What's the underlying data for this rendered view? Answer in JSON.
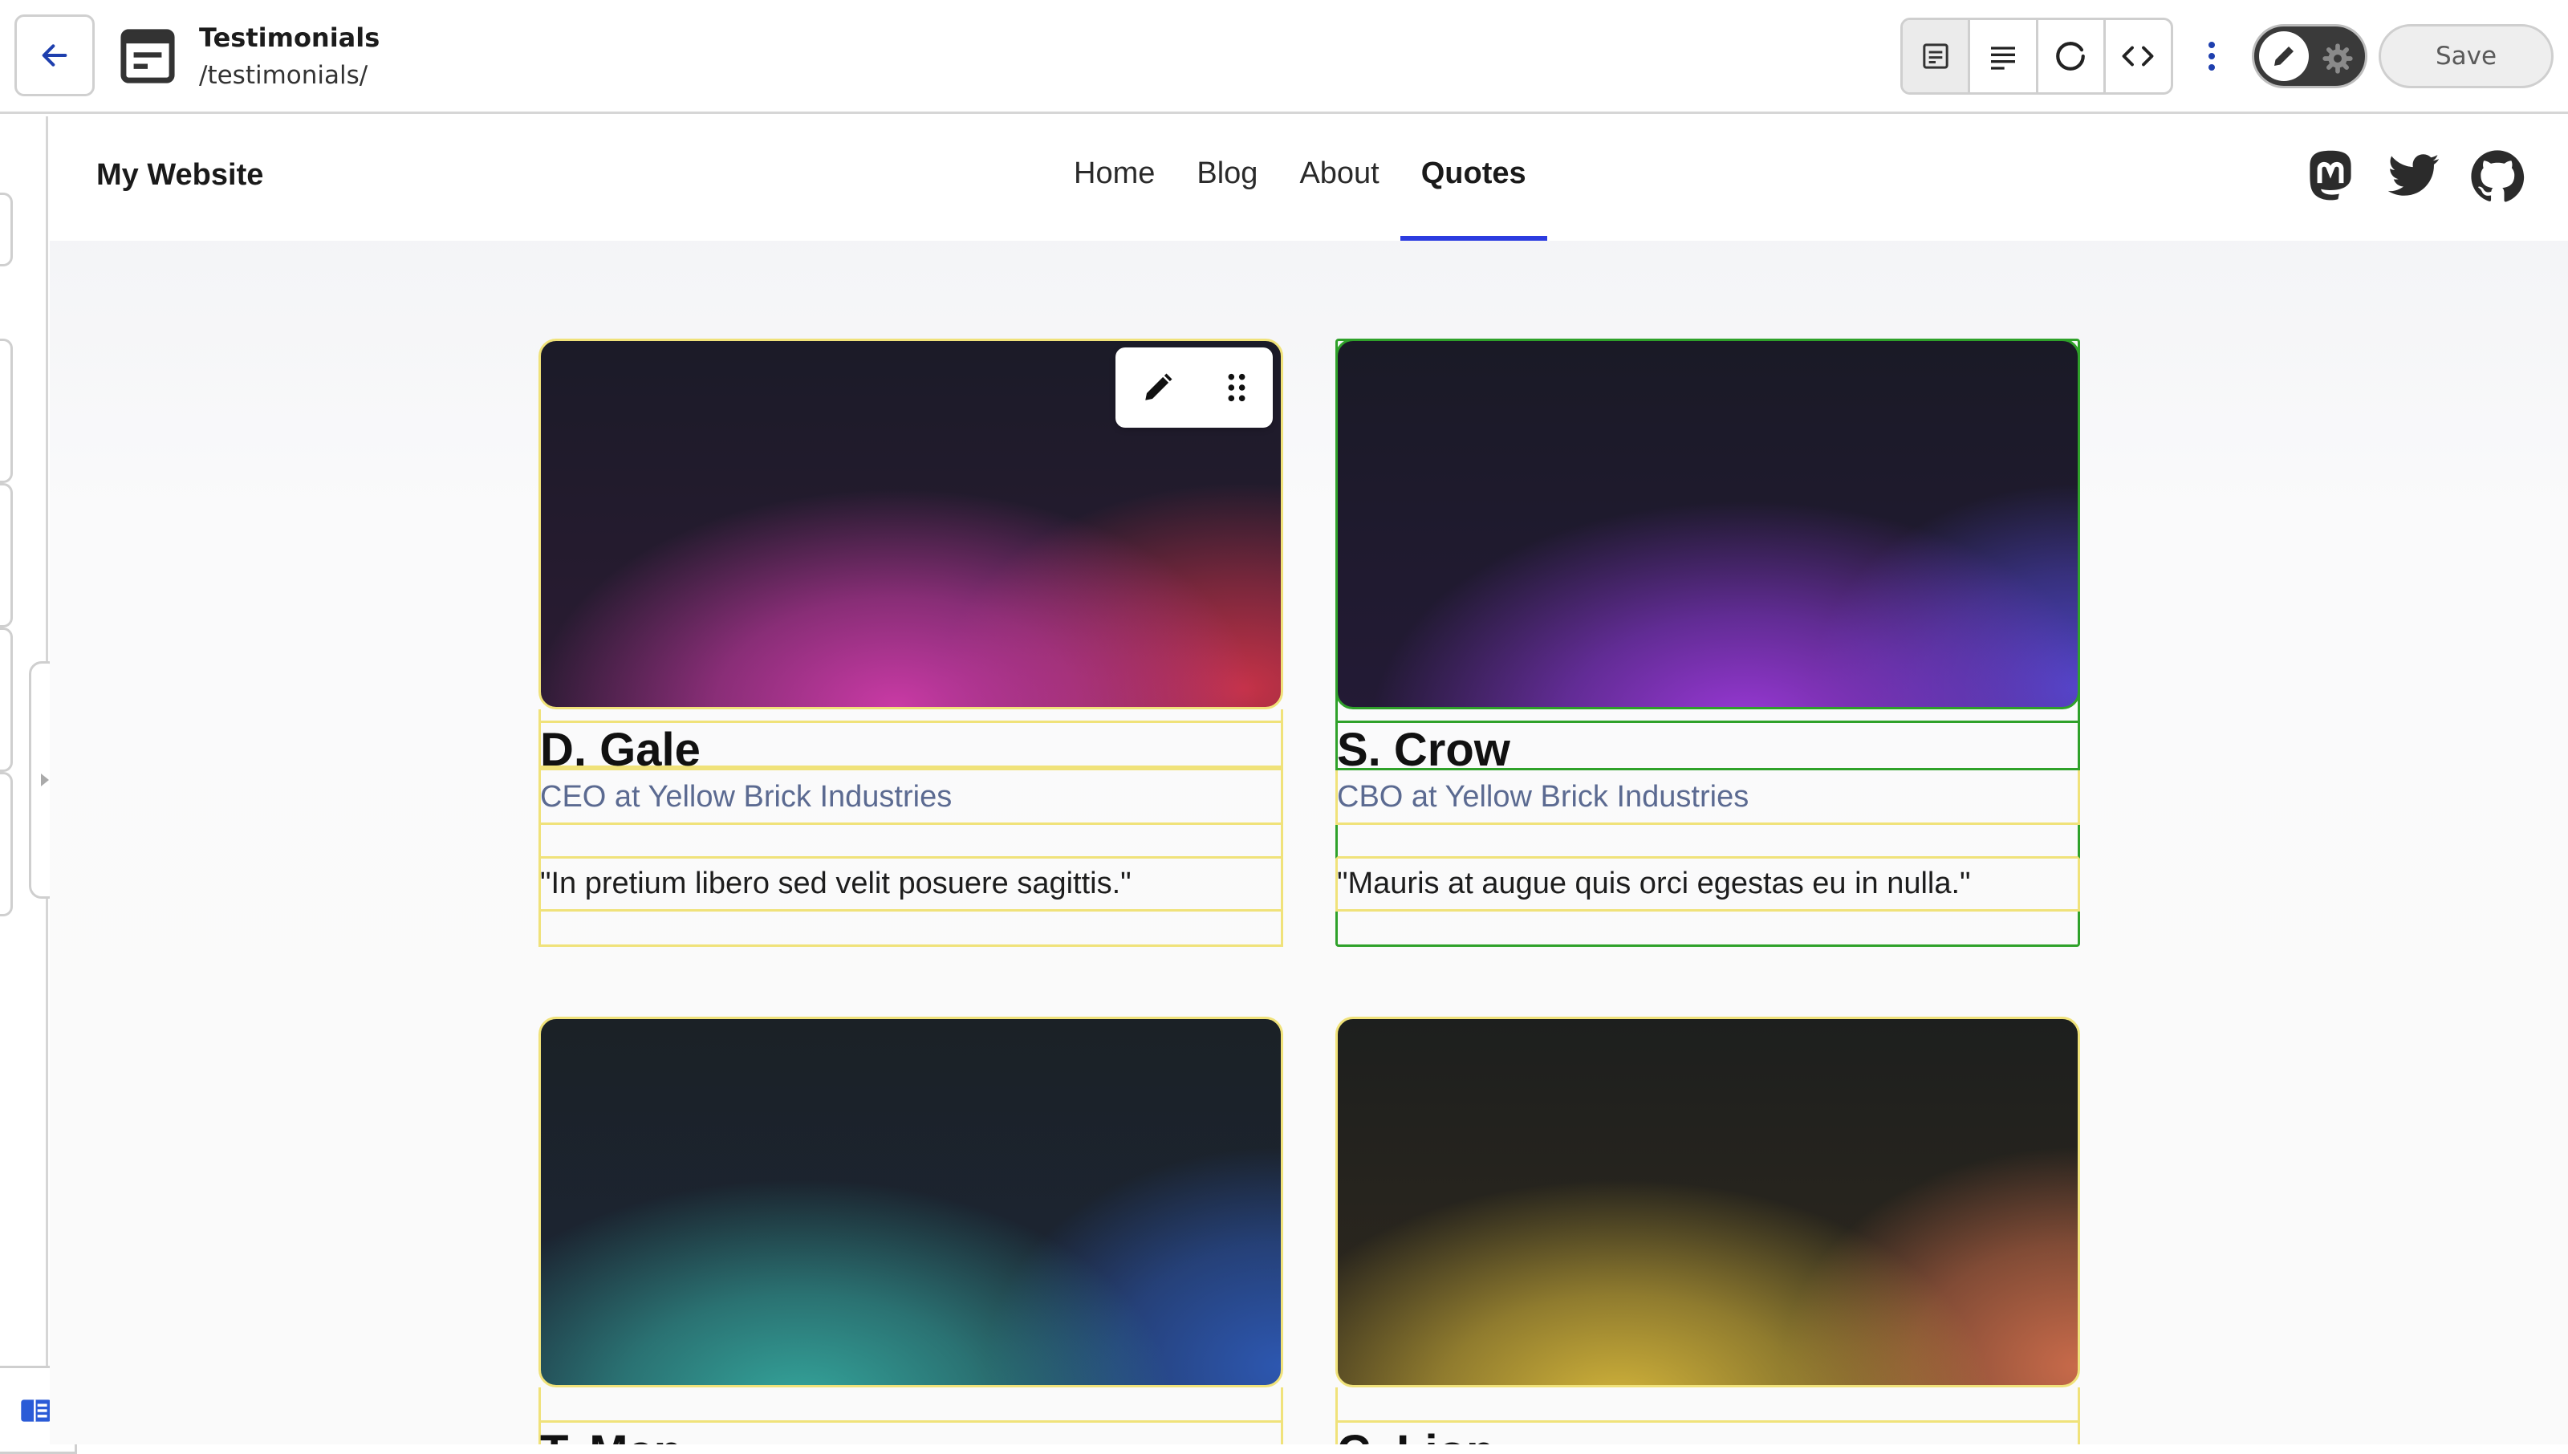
{
  "toolbar": {
    "page_title": "Testimonials",
    "page_path": "/testimonials/",
    "save_label": "Save",
    "icons": {
      "back": "arrow-left-icon",
      "page": "document-icon",
      "views": [
        "form-view-icon",
        "text-lines-icon",
        "refresh-icon",
        "code-icon"
      ],
      "more": "kebab-menu-icon",
      "edit": "pencil-icon",
      "settings": "gear-icon"
    },
    "accent_color": "#1e3fae"
  },
  "site": {
    "logo": "My Website",
    "nav": [
      {
        "label": "Home",
        "active": false
      },
      {
        "label": "Blog",
        "active": false
      },
      {
        "label": "About",
        "active": false
      },
      {
        "label": "Quotes",
        "active": true
      }
    ],
    "nav_active_color": "#2c3ce0",
    "socials": [
      "mastodon-icon",
      "twitter-icon",
      "github-icon"
    ]
  },
  "testimonials": [
    {
      "name": "D. Gale",
      "role": "CEO at Yellow Brick Industries",
      "quote": "\"In pretium libero sed velit posuere sagittis.\"",
      "gradient": "magenta-red"
    },
    {
      "name": "S. Crow",
      "role": "CBO at Yellow Brick Industries",
      "quote": "\"Mauris at augue quis orci egestas eu in nulla.\"",
      "gradient": "purple-blue"
    },
    {
      "name": "T. Man",
      "gradient": "teal-blue"
    },
    {
      "name": "C. Lion",
      "gradient": "yellow-orange"
    }
  ],
  "block_tools": [
    "pencil-icon",
    "drag-handle-icon"
  ],
  "frame_colors": {
    "hover": "#f0e27a",
    "selected": "#2fa12a"
  }
}
